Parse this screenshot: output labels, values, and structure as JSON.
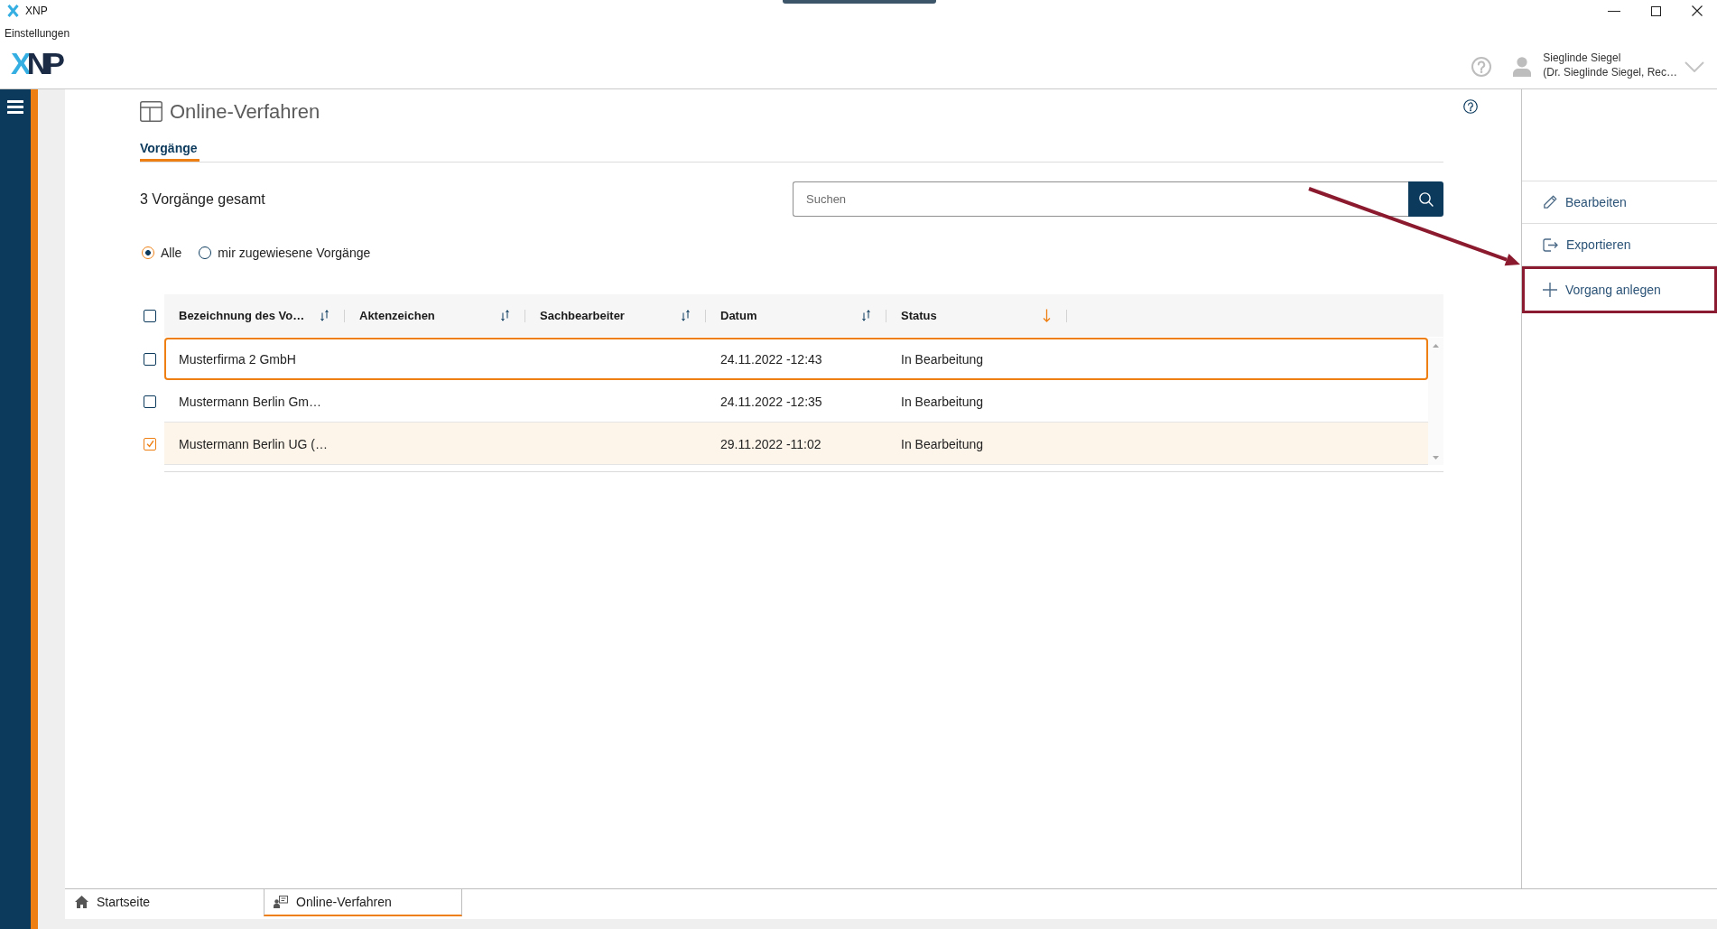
{
  "window": {
    "title": "XNP"
  },
  "menu": [
    "Einstellungen"
  ],
  "logo": {
    "accent": "X",
    "text": "NP"
  },
  "user": {
    "name": "Sieglinde Siegel",
    "detail": "(Dr. Sieglinde Siegel, Rec…"
  },
  "page": {
    "title": "Online-Verfahren",
    "tabs": [
      {
        "label": "Vorgänge",
        "selected": true
      }
    ],
    "count": "3 Vorgänge gesamt",
    "search": {
      "placeholder": "Suchen"
    },
    "filters": [
      {
        "label": "Alle",
        "selected": true
      },
      {
        "label": "mir zugewiesene Vorgänge",
        "selected": false
      }
    ],
    "table": {
      "select_all": {
        "checked": false
      },
      "columns": [
        {
          "label": "Bezeichnung des Vo…",
          "sorted": false
        },
        {
          "label": "Aktenzeichen",
          "sorted": false
        },
        {
          "label": "Sachbearbeiter",
          "sorted": false
        },
        {
          "label": "Datum",
          "sorted": false
        },
        {
          "label": "Status",
          "sorted": true
        }
      ],
      "rows": [
        {
          "checked": false,
          "focused": true,
          "designation": "Musterfirma 2 GmbH",
          "date": "24.11.2022 -12:43",
          "status": "In Bearbeitung"
        },
        {
          "checked": false,
          "focused": false,
          "designation": "Mustermann Berlin Gm…",
          "date": "24.11.2022 -12:35",
          "status": "In Bearbeitung"
        },
        {
          "checked": true,
          "focused": false,
          "designation": "Mustermann Berlin UG (…",
          "date": "29.11.2022 -11:02",
          "status": "In Bearbeitung"
        }
      ]
    }
  },
  "actions": [
    {
      "kind": "edit",
      "label": "Bearbeiten",
      "highlighted": false
    },
    {
      "kind": "export",
      "label": "Exportieren",
      "highlighted": false
    },
    {
      "kind": "add",
      "label": "Vorgang anlegen",
      "highlighted": true
    }
  ],
  "bottom_tabs": [
    {
      "kind": "home",
      "label": "Startseite",
      "selected": false
    },
    {
      "kind": "procedure",
      "label": "Online-Verfahren",
      "selected": true
    }
  ]
}
